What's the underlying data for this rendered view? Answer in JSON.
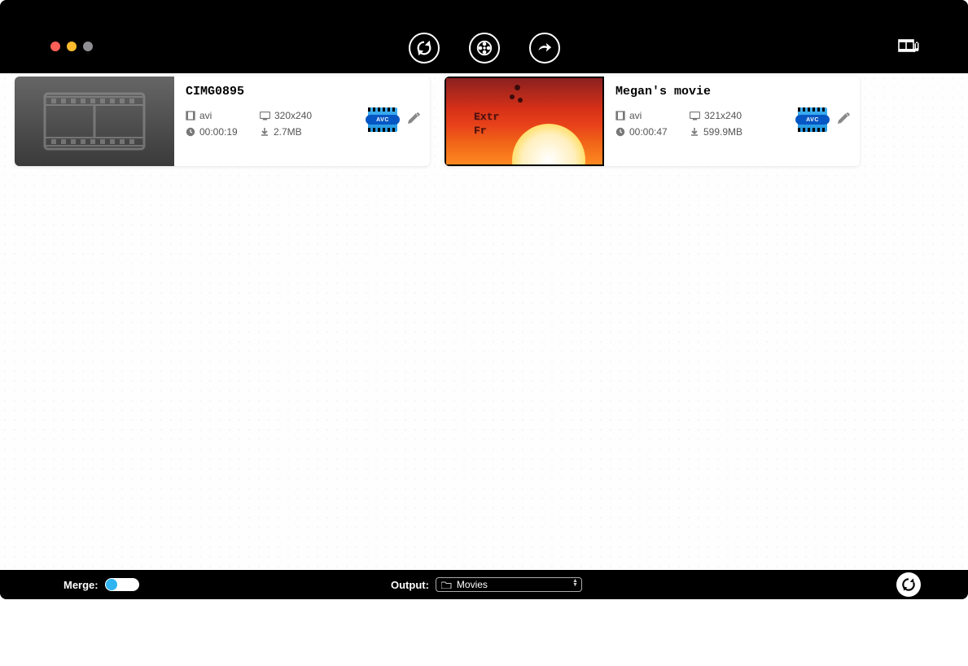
{
  "toolbar": {
    "refresh_name": "refresh",
    "reel_name": "dvd",
    "share_name": "export",
    "media_name": "media-list"
  },
  "cards": [
    {
      "title": "CIMG0895",
      "format": "avi",
      "resolution": "320x240",
      "duration": "00:00:19",
      "size": "2.7MB",
      "codec_badge": "AVC",
      "thumb_type": "placeholder"
    },
    {
      "title": "Megan's movie",
      "format": "avi",
      "resolution": "321x240",
      "duration": "00:00:47",
      "size": "599.9MB",
      "codec_badge": "AVC",
      "thumb_type": "sunset",
      "thumb_text1": "Extr",
      "thumb_text2": "Fr"
    }
  ],
  "bottombar": {
    "merge_label": "Merge:",
    "merge_on": false,
    "output_label": "Output:",
    "output_value": "Movies"
  }
}
